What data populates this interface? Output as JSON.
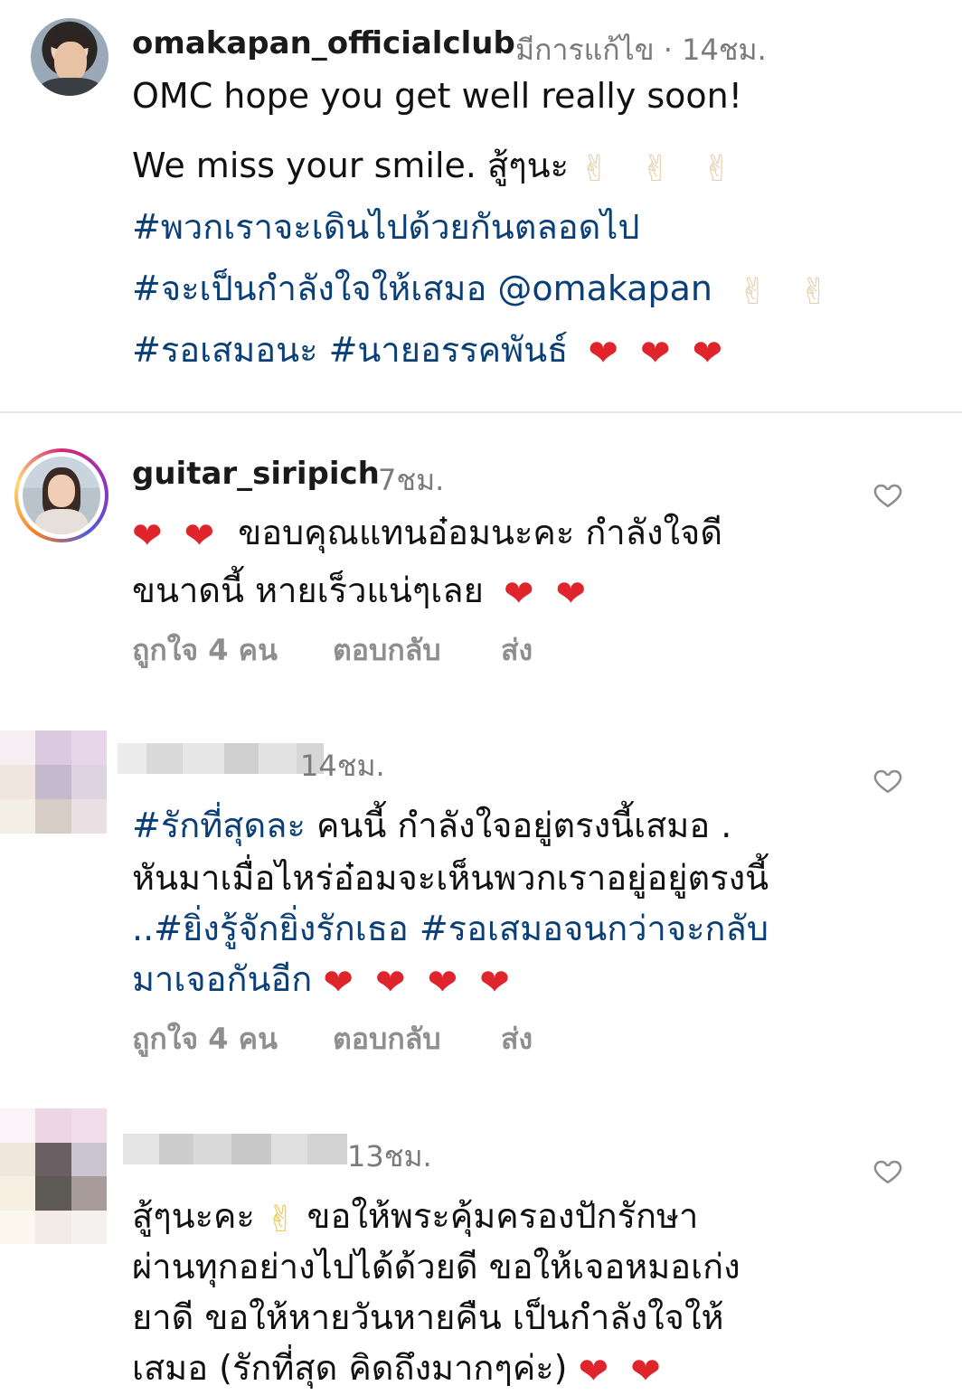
{
  "comments": [
    {
      "username": "omakapan_officialclub",
      "edited": "มีการแก้ไข",
      "time": "14ชม.",
      "lines": [
        {
          "text": "OMC hope you get well really soon!"
        },
        {
          "text": "We miss your smile.  สู้ๆนะ"
        },
        {
          "text": "#พวกเราจะเดินไปด้วยกันตลอดไป"
        },
        {
          "text": "#จะเป็นกำลังใจให้เสมอ @omakapan"
        },
        {
          "text": "#รอเสมอนะ #นายอรรคพันธ์"
        }
      ]
    },
    {
      "username": "guitar_siripich",
      "time": "7ชม.",
      "lines": [
        {
          "text": "ขอบคุณแทนอ๋อมนะคะ กำลังใจดี"
        },
        {
          "text": "ขนาดนี้ หายเร็วแน่ๆเลย"
        }
      ],
      "likes": "ถูกใจ 4 คน",
      "reply": "ตอบกลับ",
      "send": "ส่ง"
    },
    {
      "username": "",
      "time": "14ชม.",
      "lines": [
        {
          "text": "#รักที่สุดละ"
        },
        {
          "text": " คนนี้ กำลังใจอยู่ตรงนี้เสมอ ."
        },
        {
          "text": "หันมาเมื่อไหร่อ๋อมจะเห็นพวกเราอยู่อยู่ตรงนี้"
        },
        {
          "text": "..#ยิ่งรู้จักยิ่งรักเธอ #รอเสมอจนกว่าจะกลับ"
        },
        {
          "text": "มาเจอกันอีก"
        }
      ],
      "likes": "ถูกใจ 4 คน",
      "reply": "ตอบกลับ",
      "send": "ส่ง"
    },
    {
      "username": "",
      "time": "13ชม.",
      "lines": [
        {
          "text": "สู้ๆนะคะ"
        },
        {
          "text": " ขอให้พระคุ้มครองปักรักษา"
        },
        {
          "text": "ผ่านทุกอย่างไปได้ด้วยดี ขอให้เจอหมอเก่ง"
        },
        {
          "text": "ยาดี  ขอให้หายวันหายคืน เป็นกำลังใจให้"
        },
        {
          "text": "เสมอ (รักที่สุด  คิดถึงมากๆค่ะ)"
        }
      ]
    }
  ],
  "icons": {
    "heart_emoji": "❤",
    "peace_emoji": "✌",
    "like": "heart-outline-icon"
  },
  "colors": {
    "hashtag": "#0b3f78",
    "meta": "#7a7a7a",
    "heart": "#e0242c"
  }
}
